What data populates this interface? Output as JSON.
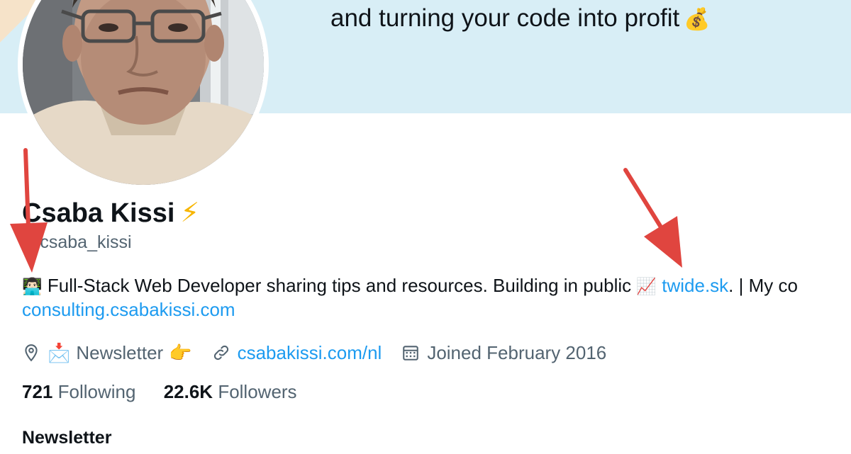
{
  "banner": {
    "text": "and turning your code into profit",
    "emoji": "💰"
  },
  "profile": {
    "name": "Csaba Kissi",
    "verified_emoji": "⚡",
    "handle": "@csaba_kissi",
    "bio": {
      "emoji_start": "👨🏻‍💻",
      "text_main": "Full-Stack Web Developer sharing tips and resources. Building in public",
      "emoji_chart": "📈",
      "link1": "twide.sk",
      "text_after_link": ". | My co",
      "link2": "consulting.csabakissi.com"
    },
    "meta": {
      "location_icon": "location-pin-icon",
      "location_emoji": "📩",
      "location_text": "Newsletter",
      "location_emoji_end": "👉",
      "link_icon": "link-icon",
      "link_text": "csabakissi.com/nl",
      "calendar_icon": "calendar-icon",
      "joined_text": "Joined February 2016"
    },
    "stats": {
      "following_count": "721",
      "following_label": "Following",
      "followers_count": "22.6K",
      "followers_label": "Followers"
    }
  },
  "section": {
    "title": "Newsletter"
  },
  "annotations": {
    "arrow_color": "#e0453f",
    "link_color": "#1d9bf0",
    "banner_color": "#d8eef6"
  }
}
